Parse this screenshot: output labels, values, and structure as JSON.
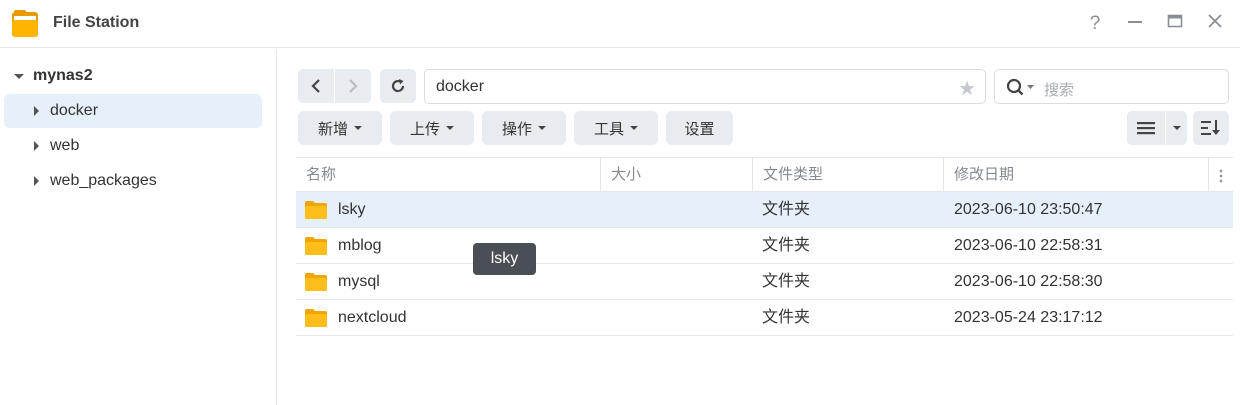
{
  "window": {
    "title": "File Station",
    "controls": {
      "help": "?",
      "minimize": "—",
      "maximize": "▭",
      "close": "✕"
    }
  },
  "sidebar": {
    "root": "mynas2",
    "items": [
      {
        "label": "docker",
        "selected": true
      },
      {
        "label": "web",
        "selected": false
      },
      {
        "label": "web_packages",
        "selected": false
      }
    ]
  },
  "toolbar": {
    "path": "docker",
    "search_placeholder": "搜索",
    "buttons": {
      "create": "新增",
      "upload": "上传",
      "action": "操作",
      "tools": "工具",
      "settings": "设置"
    }
  },
  "table": {
    "columns": {
      "name": "名称",
      "size": "大小",
      "type": "文件类型",
      "modified": "修改日期"
    },
    "rows": [
      {
        "name": "lsky",
        "size": "",
        "type": "文件夹",
        "modified": "2023-06-10 23:50:47"
      },
      {
        "name": "mblog",
        "size": "",
        "type": "文件夹",
        "modified": "2023-06-10 22:58:31"
      },
      {
        "name": "mysql",
        "size": "",
        "type": "文件夹",
        "modified": "2023-06-10 22:58:30"
      },
      {
        "name": "nextcloud",
        "size": "",
        "type": "文件夹",
        "modified": "2023-05-24 23:17:12"
      }
    ]
  },
  "tooltip": "lsky",
  "colors": {
    "selection": "#e6f0fb",
    "folder": "#f7b500",
    "button_bg": "#e8ecf0"
  }
}
